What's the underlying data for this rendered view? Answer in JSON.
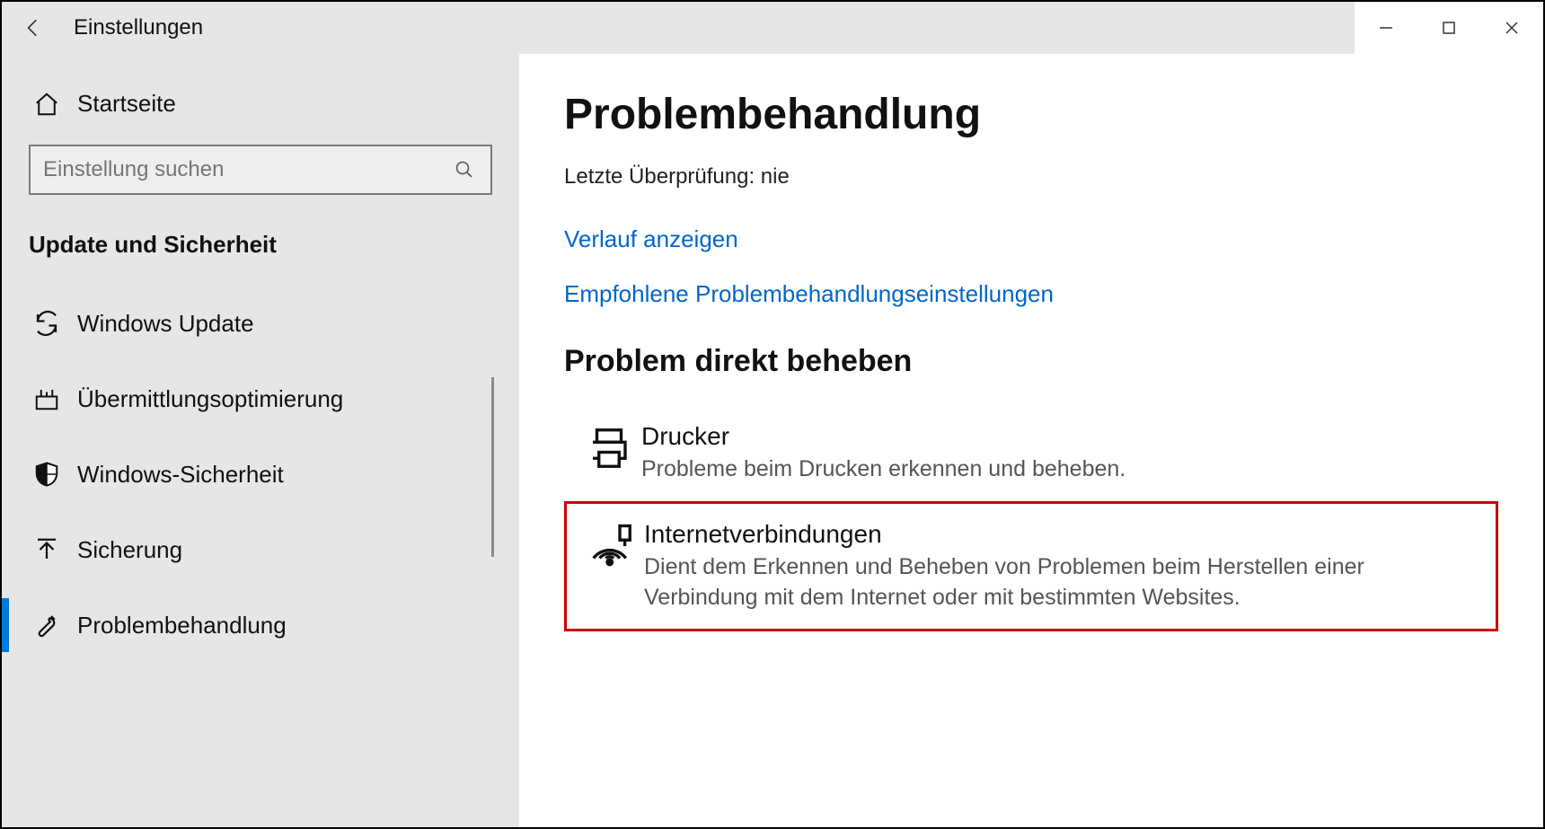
{
  "titlebar": {
    "title": "Einstellungen"
  },
  "sidebar": {
    "home_label": "Startseite",
    "search_placeholder": "Einstellung suchen",
    "section_header": "Update und Sicherheit",
    "items": [
      {
        "label": "Windows Update"
      },
      {
        "label": "Übermittlungsoptimierung"
      },
      {
        "label": "Windows-Sicherheit"
      },
      {
        "label": "Sicherung"
      },
      {
        "label": "Problembehandlung"
      }
    ]
  },
  "main": {
    "page_title": "Problembehandlung",
    "last_check": "Letzte Überprüfung: nie",
    "link_history": "Verlauf anzeigen",
    "link_recommended": "Empfohlene Problembehandlungseinstellungen",
    "sub_header": "Problem direkt beheben",
    "troubleshooters": [
      {
        "title": "Drucker",
        "desc": "Probleme beim Drucken erkennen und beheben."
      },
      {
        "title": "Internetverbindungen",
        "desc": "Dient dem Erkennen und Beheben von Problemen beim Herstellen einer Verbindung mit dem Internet oder mit bestimmten Websites."
      }
    ]
  }
}
